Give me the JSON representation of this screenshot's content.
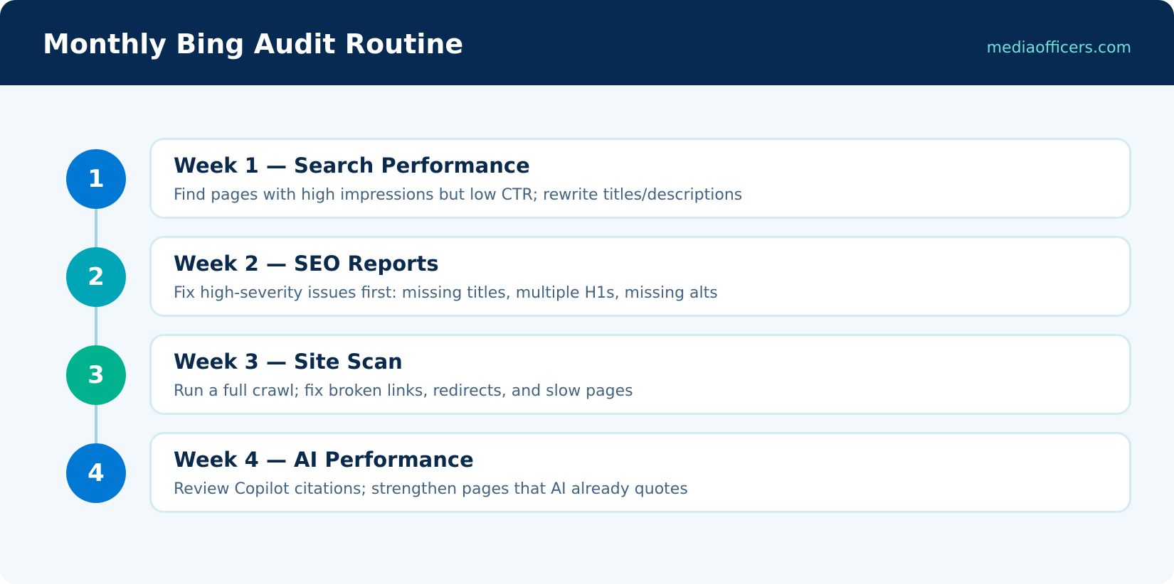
{
  "header": {
    "title": "Monthly Bing Audit Routine",
    "site": "mediaofficers.com"
  },
  "colors": {
    "header_bg": "#062a51",
    "page_bg": "#f3f8fc",
    "site_text": "#6ee0d8",
    "connector": "#a3cfe8",
    "card_border": "#d3ebf5",
    "card_title": "#0a2a4d",
    "card_text": "#436383"
  },
  "steps": [
    {
      "number": "1",
      "title": "Week 1 — Search Performance",
      "description": "Find pages with high impressions but low CTR; rewrite titles/descriptions",
      "color": "#0078d4"
    },
    {
      "number": "2",
      "title": "Week 2 — SEO Reports",
      "description": "Fix high-severity issues first: missing titles, multiple H1s, missing alts",
      "color": "#00a5b8"
    },
    {
      "number": "3",
      "title": "Week 3 — Site Scan",
      "description": "Run a full crawl; fix broken links, redirects, and slow pages",
      "color": "#00b38e"
    },
    {
      "number": "4",
      "title": "Week 4 — AI Performance",
      "description": "Review Copilot citations; strengthen pages that AI already quotes",
      "color": "#0078d4"
    }
  ]
}
